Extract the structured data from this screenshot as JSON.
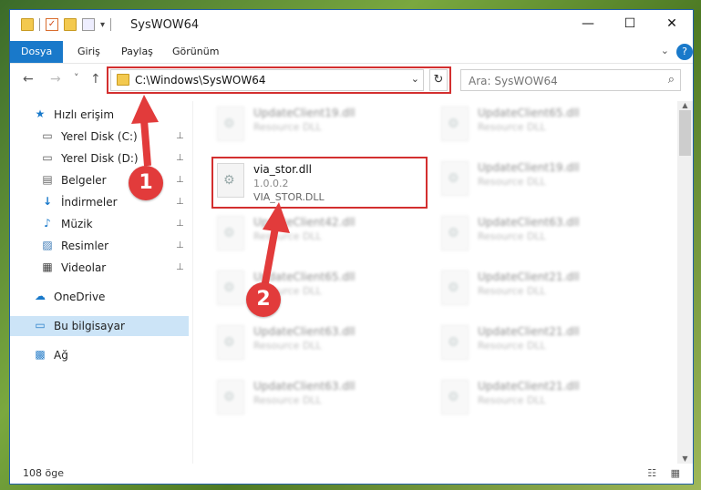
{
  "window": {
    "title": "SysWOW64",
    "controls": {
      "minimize": "—",
      "maximize": "☐",
      "close": "✕"
    }
  },
  "qat": {
    "dropdown": "▾"
  },
  "ribbon": {
    "tabs": [
      "Dosya",
      "Giriş",
      "Paylaş",
      "Görünüm"
    ],
    "expand": "⌄",
    "help": "?"
  },
  "nav": {
    "back": "←",
    "forward": "→",
    "recent": "˅",
    "up": "↑",
    "address": "C:\\Windows\\SysWOW64",
    "address_dropdown": "⌄",
    "refresh": "↻",
    "search_placeholder": "Ara: SysWOW64",
    "search_icon": "⌕"
  },
  "sidebar": {
    "items": [
      {
        "label": "Hızlı erişim",
        "icon": "star-icon",
        "glyph": "★",
        "pinned": false
      },
      {
        "label": "Yerel Disk (C:)",
        "icon": "drive-icon",
        "glyph": "▭",
        "pinned": true
      },
      {
        "label": "Yerel Disk (D:)",
        "icon": "drive-icon",
        "glyph": "▭",
        "pinned": true
      },
      {
        "label": "Belgeler",
        "icon": "document-icon",
        "glyph": "▤",
        "pinned": true
      },
      {
        "label": "İndirmeler",
        "icon": "download-icon",
        "glyph": "↓",
        "pinned": true
      },
      {
        "label": "Müzik",
        "icon": "music-icon",
        "glyph": "♪",
        "pinned": true
      },
      {
        "label": "Resimler",
        "icon": "pictures-icon",
        "glyph": "▨",
        "pinned": true
      },
      {
        "label": "Videolar",
        "icon": "video-icon",
        "glyph": "▦",
        "pinned": true
      },
      {
        "label": "OneDrive",
        "icon": "cloud-icon",
        "glyph": "☁",
        "pinned": false
      },
      {
        "label": "Bu bilgisayar",
        "icon": "computer-icon",
        "glyph": "▭",
        "pinned": false
      },
      {
        "label": "Ağ",
        "icon": "network-icon",
        "glyph": "▩",
        "pinned": false
      }
    ],
    "pin_glyph": "📌"
  },
  "content": {
    "selected_file": {
      "name": "via_stor.dll",
      "version": "1.0.0.2",
      "description": "VIA_STOR.DLL"
    },
    "files_left": [
      {
        "name": "UpdateClient19.dll",
        "sub": "Resource DLL"
      },
      {
        "name": "UpdateClient42.dll",
        "sub": "Resource DLL"
      },
      {
        "name": "UpdateClient65.dll",
        "sub": "Resource DLL"
      },
      {
        "name": "UpdateClient63.dll",
        "sub": "Resource DLL"
      },
      {
        "name": "UpdateClient63.dll",
        "sub": "Resource DLL"
      }
    ],
    "files_right": [
      {
        "name": "UpdateClient65.dll",
        "sub": "Resource DLL"
      },
      {
        "name": "UpdateClient19.dll",
        "sub": "Resource DLL"
      },
      {
        "name": "UpdateClient63.dll",
        "sub": "Resource DLL"
      },
      {
        "name": "UpdateClient21.dll",
        "sub": "Resource DLL"
      },
      {
        "name": "UpdateClient21.dll",
        "sub": "Resource DLL"
      },
      {
        "name": "UpdateClient21.dll",
        "sub": "Resource DLL"
      }
    ]
  },
  "status": {
    "count": "108 öge",
    "views": "☷ ▦"
  },
  "callouts": [
    "1",
    "2"
  ],
  "colors": {
    "accent": "#1979ca",
    "highlight": "#d32f2f",
    "callout": "#e23b3b"
  }
}
